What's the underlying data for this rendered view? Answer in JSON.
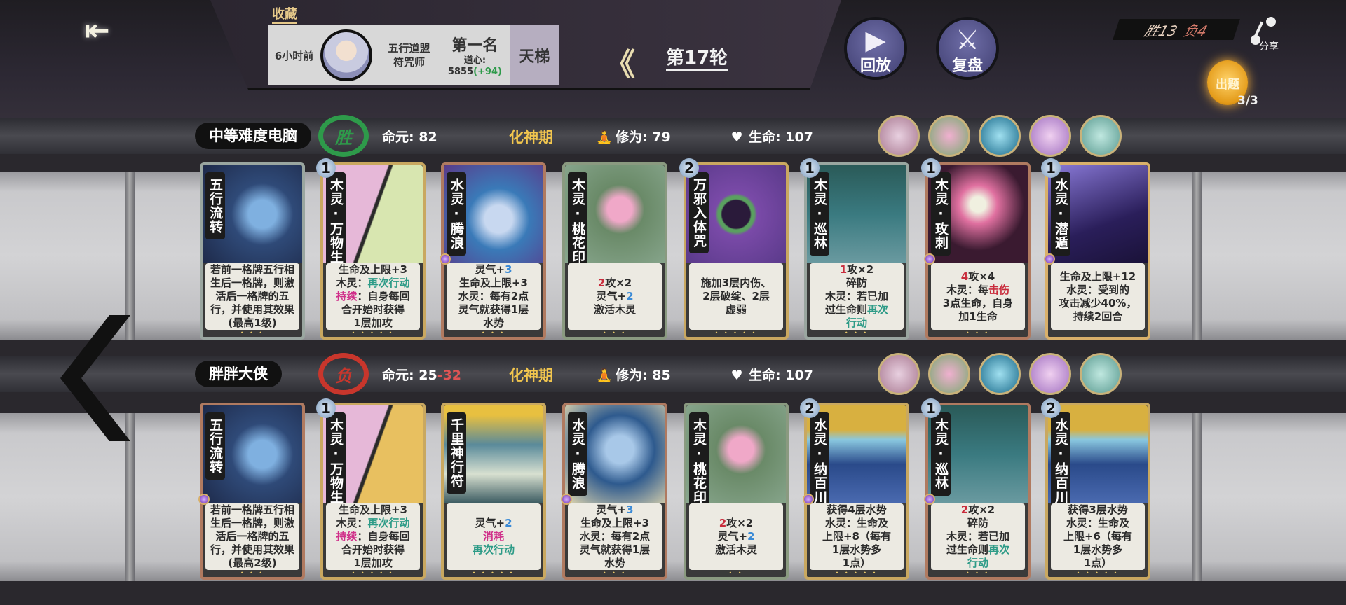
{
  "header": {
    "back_icon": "back-arrow-icon",
    "favorite_label": "收藏",
    "record": {
      "time": "6小时前",
      "opponent_line1": "五行道盟",
      "opponent_line2": "符咒师",
      "rank": "第一名",
      "score_label": "道心:",
      "score": "5855",
      "score_delta": "(+94)",
      "mode": "天梯"
    },
    "round_label": "第17轮",
    "replay_label": "回放",
    "review_label": "复盘",
    "win_label": "胜13",
    "loss_label": "负4",
    "share_label": "分享",
    "quiz_label": "出题",
    "quiz_count": "3/3"
  },
  "colors": {
    "win": "#2e9a4a",
    "loss": "#c8362c",
    "accent": "#f2c64e"
  },
  "players": [
    {
      "name": "中等难度电脑",
      "result": "胜",
      "mingyuan_label": "命元:",
      "mingyuan": "82",
      "mingyuan_loss": "",
      "stage": "化神期",
      "xiuwei_label": "修为:",
      "xiuwei": "79",
      "life_label": "生命:",
      "life": "107",
      "cards": [
        {
          "cost": "",
          "name": "五行流转",
          "gem": false,
          "art": "wuxing",
          "frame": "#9aa6a0",
          "dots": "• • •",
          "desc": [
            [
              [
                "若前一格牌五行相",
                ""
              ]
            ],
            [
              [
                "生后一格牌，则激",
                ""
              ]
            ],
            [
              [
                "活后一格牌的五",
                ""
              ]
            ],
            [
              [
                "行，并使用其效果",
                ""
              ]
            ],
            [
              [
                "(最高1级)",
                ""
              ]
            ]
          ]
        },
        {
          "cost": "1",
          "name": "木灵·万物生",
          "gem": false,
          "art": "wanwu",
          "frame": "#c9a860",
          "dots": "• • • • •",
          "desc": [
            [
              [
                "生命及上限+3",
                ""
              ]
            ],
            [
              [
                "木灵：",
                ""
              ],
              [
                "再次行动",
                "teal"
              ]
            ],
            [
              [
                "持续",
                "mag"
              ],
              [
                "：自身每回",
                ""
              ]
            ],
            [
              [
                "合开始时获得",
                ""
              ]
            ],
            [
              [
                "1层加攻",
                ""
              ]
            ]
          ]
        },
        {
          "cost": "",
          "name": "水灵·腾浪",
          "gem": true,
          "art": "tenglang",
          "frame": "#b07a60",
          "dots": "• • •",
          "desc": [
            [
              [
                "灵气+",
                ""
              ],
              [
                "3",
                "blue"
              ]
            ],
            [
              [
                "生命及上限+3",
                ""
              ]
            ],
            [
              [
                "水灵：每有2点",
                ""
              ]
            ],
            [
              [
                "灵气就获得1层",
                ""
              ]
            ],
            [
              [
                "水势",
                ""
              ]
            ]
          ]
        },
        {
          "cost": "",
          "name": "木灵·桃花印",
          "gem": false,
          "art": "taohua",
          "frame": "#8a9a80",
          "dots": "• • •",
          "desc": [
            [
              [
                "2",
                "red"
              ],
              [
                "攻×2",
                ""
              ]
            ],
            [
              [
                "灵气+",
                ""
              ],
              [
                "2",
                "blue"
              ]
            ],
            [
              [
                "激活木灵",
                ""
              ]
            ]
          ]
        },
        {
          "cost": "2",
          "name": "万邪入体咒",
          "gem": false,
          "art": "wanxie",
          "frame": "#c9a860",
          "dots": "• • • • •",
          "desc": [
            [
              [
                "施加3层内伤、",
                ""
              ]
            ],
            [
              [
                "2层破绽、2层",
                ""
              ]
            ],
            [
              [
                "虚弱",
                ""
              ]
            ]
          ]
        },
        {
          "cost": "1",
          "name": "木灵·巡林",
          "gem": false,
          "art": "xunlin",
          "frame": "#9aa6a0",
          "dots": "• • •",
          "desc": [
            [
              [
                "1",
                "red"
              ],
              [
                "攻×2",
                ""
              ]
            ],
            [
              [
                "碎防",
                ""
              ]
            ],
            [
              [
                "木灵：若已加",
                ""
              ]
            ],
            [
              [
                "过生命则",
                ""
              ],
              [
                "再次",
                "teal"
              ]
            ],
            [
              [
                "行动",
                "teal"
              ]
            ]
          ]
        },
        {
          "cost": "1",
          "name": "木灵·玫刺",
          "gem": true,
          "art": "meici",
          "frame": "#b07a60",
          "dots": "• • •",
          "desc": [
            [
              [
                "4",
                "red"
              ],
              [
                "攻×4",
                ""
              ]
            ],
            [
              [
                "木灵：每",
                ""
              ],
              [
                "击伤",
                "red"
              ]
            ],
            [
              [
                "3点生命，自身",
                ""
              ]
            ],
            [
              [
                "加1生命",
                ""
              ]
            ]
          ]
        },
        {
          "cost": "1",
          "name": "水灵·潜遁",
          "gem": true,
          "art": "qiandun",
          "frame": "#d9b06a",
          "dots": "",
          "desc": [
            [
              [
                "生命及上限+12",
                ""
              ]
            ],
            [
              [
                "水灵：受到的",
                ""
              ]
            ],
            [
              [
                "攻击减少40%，",
                ""
              ]
            ],
            [
              [
                "持续2回合",
                ""
              ]
            ]
          ]
        }
      ]
    },
    {
      "name": "胖胖大侠",
      "result": "负",
      "mingyuan_label": "命元:",
      "mingyuan": "25",
      "mingyuan_loss": "-32",
      "stage": "化神期",
      "xiuwei_label": "修为:",
      "xiuwei": "85",
      "life_label": "生命:",
      "life": "107",
      "cards": [
        {
          "cost": "",
          "name": "五行流转",
          "gem": true,
          "art": "wuxing",
          "frame": "#b07a60",
          "dots": "• • •",
          "desc": [
            [
              [
                "若前一格牌五行相",
                ""
              ]
            ],
            [
              [
                "生后一格牌，则激",
                ""
              ]
            ],
            [
              [
                "活后一格牌的五",
                ""
              ]
            ],
            [
              [
                "行，并使用其效果",
                ""
              ]
            ],
            [
              [
                "(最高2级)",
                ""
              ]
            ]
          ]
        },
        {
          "cost": "1",
          "name": "木灵·万物生",
          "gem": false,
          "art": "wanwu2",
          "frame": "#c9a860",
          "dots": "• • • • •",
          "desc": [
            [
              [
                "生命及上限+3",
                ""
              ]
            ],
            [
              [
                "木灵：",
                ""
              ],
              [
                "再次行动",
                "teal"
              ]
            ],
            [
              [
                "持续",
                "mag"
              ],
              [
                "：自身每回",
                ""
              ]
            ],
            [
              [
                "合开始时获得",
                ""
              ]
            ],
            [
              [
                "1层加攻",
                ""
              ]
            ]
          ]
        },
        {
          "cost": "",
          "name": "千里神行符",
          "gem": false,
          "art": "qianli",
          "frame": "#c9a860",
          "dots": "• • • • •",
          "desc": [
            [
              [
                "灵气+",
                ""
              ],
              [
                "2",
                "blue"
              ]
            ],
            [
              [
                "消耗",
                "mag"
              ]
            ],
            [
              [
                "再次行动",
                "teal"
              ]
            ]
          ]
        },
        {
          "cost": "",
          "name": "水灵·腾浪",
          "gem": true,
          "art": "tenglang2",
          "frame": "#b07a60",
          "dots": "• • •",
          "desc": [
            [
              [
                "灵气+",
                ""
              ],
              [
                "3",
                "blue"
              ]
            ],
            [
              [
                "生命及上限+3",
                ""
              ]
            ],
            [
              [
                "水灵：每有2点",
                ""
              ]
            ],
            [
              [
                "灵气就获得1层",
                ""
              ]
            ],
            [
              [
                "水势",
                ""
              ]
            ]
          ]
        },
        {
          "cost": "",
          "name": "木灵·桃花印",
          "gem": false,
          "art": "taohua",
          "frame": "#8a9a80",
          "dots": "• •",
          "desc": [
            [
              [
                "2",
                "red"
              ],
              [
                "攻×2",
                ""
              ]
            ],
            [
              [
                "灵气+",
                ""
              ],
              [
                "2",
                "blue"
              ]
            ],
            [
              [
                "激活木灵",
                ""
              ]
            ]
          ]
        },
        {
          "cost": "2",
          "name": "水灵·纳百川",
          "gem": true,
          "art": "nabai",
          "frame": "#c9a860",
          "dots": "• • • • •",
          "desc": [
            [
              [
                "获得4层水势",
                ""
              ]
            ],
            [
              [
                "水灵：生命及",
                ""
              ]
            ],
            [
              [
                "上限+8（每有",
                ""
              ]
            ],
            [
              [
                "1层水势多",
                ""
              ]
            ],
            [
              [
                "1点）",
                ""
              ]
            ]
          ]
        },
        {
          "cost": "1",
          "name": "木灵·巡林",
          "gem": true,
          "art": "xunlin",
          "frame": "#b07a60",
          "dots": "• • •",
          "desc": [
            [
              [
                "2",
                "red"
              ],
              [
                "攻×2",
                ""
              ]
            ],
            [
              [
                "碎防",
                ""
              ]
            ],
            [
              [
                "木灵：若已加",
                ""
              ]
            ],
            [
              [
                "过生命则",
                ""
              ],
              [
                "再次",
                "teal"
              ]
            ],
            [
              [
                "行动",
                "teal"
              ]
            ]
          ]
        },
        {
          "cost": "2",
          "name": "水灵·纳百川",
          "gem": false,
          "art": "nabai",
          "frame": "#c9a860",
          "dots": "• • • • •",
          "desc": [
            [
              [
                "获得3层水势",
                ""
              ]
            ],
            [
              [
                "水灵：生命及",
                ""
              ]
            ],
            [
              [
                "上限+6（每有",
                ""
              ]
            ],
            [
              [
                "1层水势多",
                ""
              ]
            ],
            [
              [
                "1点）",
                ""
              ]
            ]
          ]
        }
      ]
    }
  ],
  "relics": [
    "sword-maiden-relic-icon",
    "peach-blossom-relic-icon",
    "water-swirl-relic-icon",
    "plum-branch-relic-icon",
    "dancer-relic-icon"
  ]
}
